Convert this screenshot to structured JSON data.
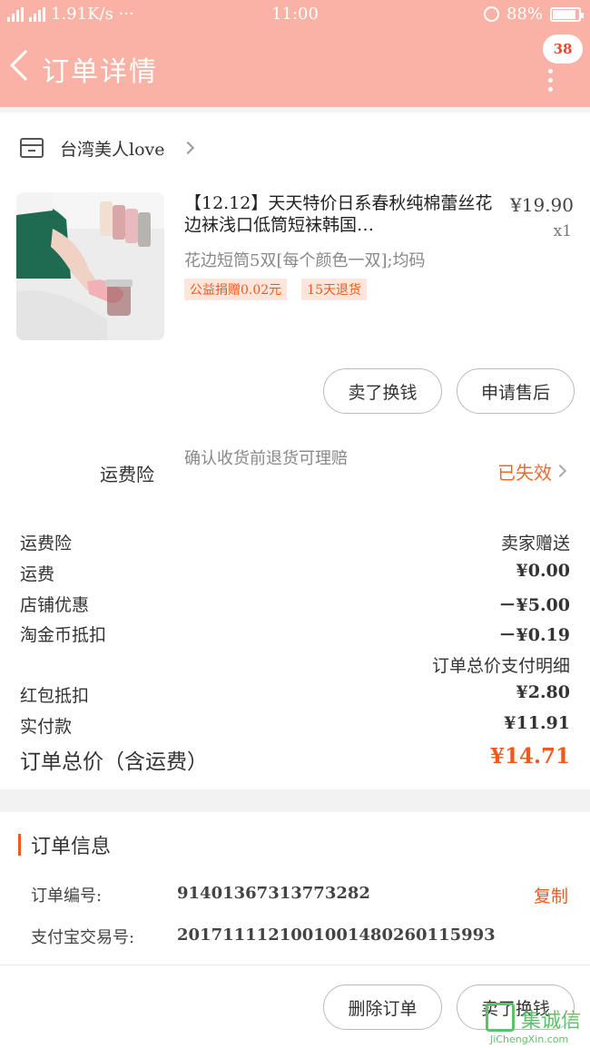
{
  "status_bar": {
    "network": "4G 4G",
    "speed": "1.91K/s ···",
    "time": "11:00",
    "battery": "88%",
    "battery_level": 0.88
  },
  "header": {
    "title": "订单详情",
    "badge": "38"
  },
  "shop": {
    "name": "台湾美人love"
  },
  "product": {
    "title": "【12.12】天天特价日系春秋纯棉蕾丝花边袜浅口低筒短袜韩国…",
    "price": "¥19.90",
    "qty": "x1",
    "sku": "花边短筒5双[每个颜色一双];均码",
    "tags": [
      "公益捐赠0.02元",
      "15天退货"
    ]
  },
  "buttons": {
    "sell": "卖了换钱",
    "after_sale": "申请售后",
    "delete": "删除订单",
    "sell2": "卖了换钱"
  },
  "insurance": {
    "label": "运费险",
    "desc": "确认收货前退货可理赔",
    "status": "已失效"
  },
  "summary": {
    "rows": [
      {
        "k": "运费险",
        "v": "卖家赠送"
      },
      {
        "k": "运费",
        "v": "¥0.00"
      },
      {
        "k": "店铺优惠",
        "v": "－¥5.00"
      },
      {
        "k": "淘金币抵扣",
        "v": "－¥0.19"
      },
      {
        "k": "",
        "v": "订单总价支付明细"
      },
      {
        "k": "红包抵扣",
        "v": "¥2.80"
      },
      {
        "k": "实付款",
        "v": "¥11.91"
      }
    ],
    "total_label": "订单总价（含运费）",
    "total_value": "¥14.71"
  },
  "order_info": {
    "heading": "订单信息",
    "order_no_label": "订单编号:",
    "order_no": "91401367313773282",
    "copy": "复制",
    "alipay_label": "支付宝交易号:",
    "alipay_no": "2017111121001001480260115993"
  },
  "watermark": {
    "cn": "集诚信",
    "en": "JiChengXin.com"
  },
  "colors": {
    "header_bg": "#f9b2a5",
    "accent": "#ef5a1c"
  }
}
